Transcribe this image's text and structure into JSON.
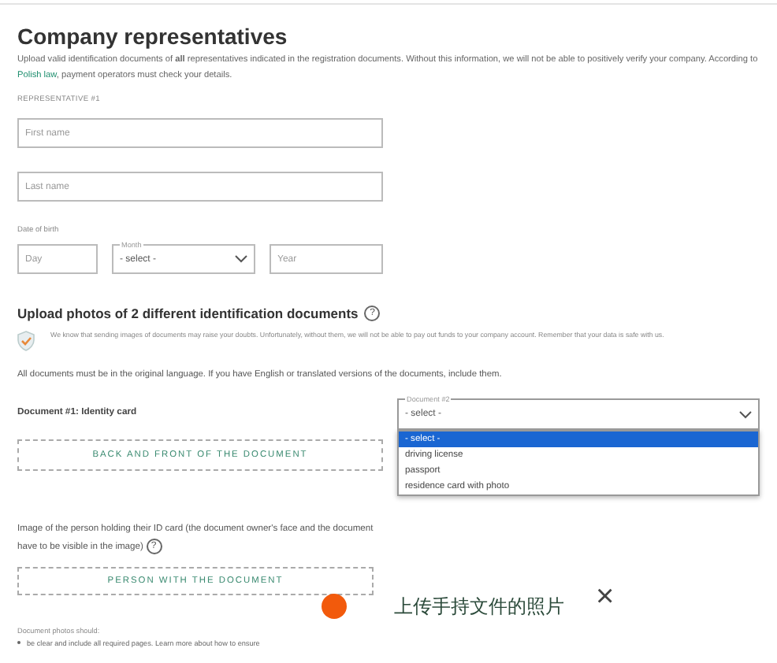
{
  "title": "Company representatives",
  "intro": "Upload valid identification documents of **all** representatives indicated in the registration documents. Without this information, we will not be able to positively verify your company. According to ",
  "intro_link": "Polish law",
  "intro_end": ", payment operators must check your details.",
  "representative_label": "REPRESENTATIVE #1",
  "fields": [
    {
      "placeholder": "First name"
    },
    {
      "placeholder": "Last name"
    }
  ],
  "birth": {
    "label": "Date of birth",
    "day": {
      "placeholder": "Day"
    },
    "month": {
      "label": "Month",
      "value": "- select -"
    },
    "year": {
      "placeholder": "Year"
    }
  },
  "upload": {
    "heading": "Upload photos of 2 different identification documents",
    "help": "?",
    "notice": "We know that sending images of documents may raise your doubts. Unfortunately, without them, we will not be able to pay out funds to your company account. Remember that your data is safe with us.",
    "language_note": "All documents must be in the original language. If you have English or translated versions of the documents, include them."
  },
  "document1": {
    "label": "Document #1: Identity card",
    "button": "BACK AND FRONT OF THE DOCUMENT"
  },
  "document2": {
    "label": "Document #2",
    "value": "- select -",
    "options": [
      {
        "label": "- select -",
        "selected": true
      },
      {
        "label": "driving license",
        "selected": false
      },
      {
        "label": "passport",
        "selected": false
      },
      {
        "label": "residence card with photo",
        "selected": false
      }
    ]
  },
  "person": {
    "text": "Image of the person holding their ID card (the document owner's face and the document have to be visible in the image)",
    "help": "?",
    "button": "PERSON WITH THE DOCUMENT"
  },
  "photos": {
    "heading": "Document photos should:",
    "items": [
      "be clear and include all required pages. Learn more about how to ensure"
    ]
  },
  "markers": [
    {
      "kind": "active"
    }
  ],
  "caption": {
    "text": "上传手持文件的照片",
    "close": "×"
  }
}
